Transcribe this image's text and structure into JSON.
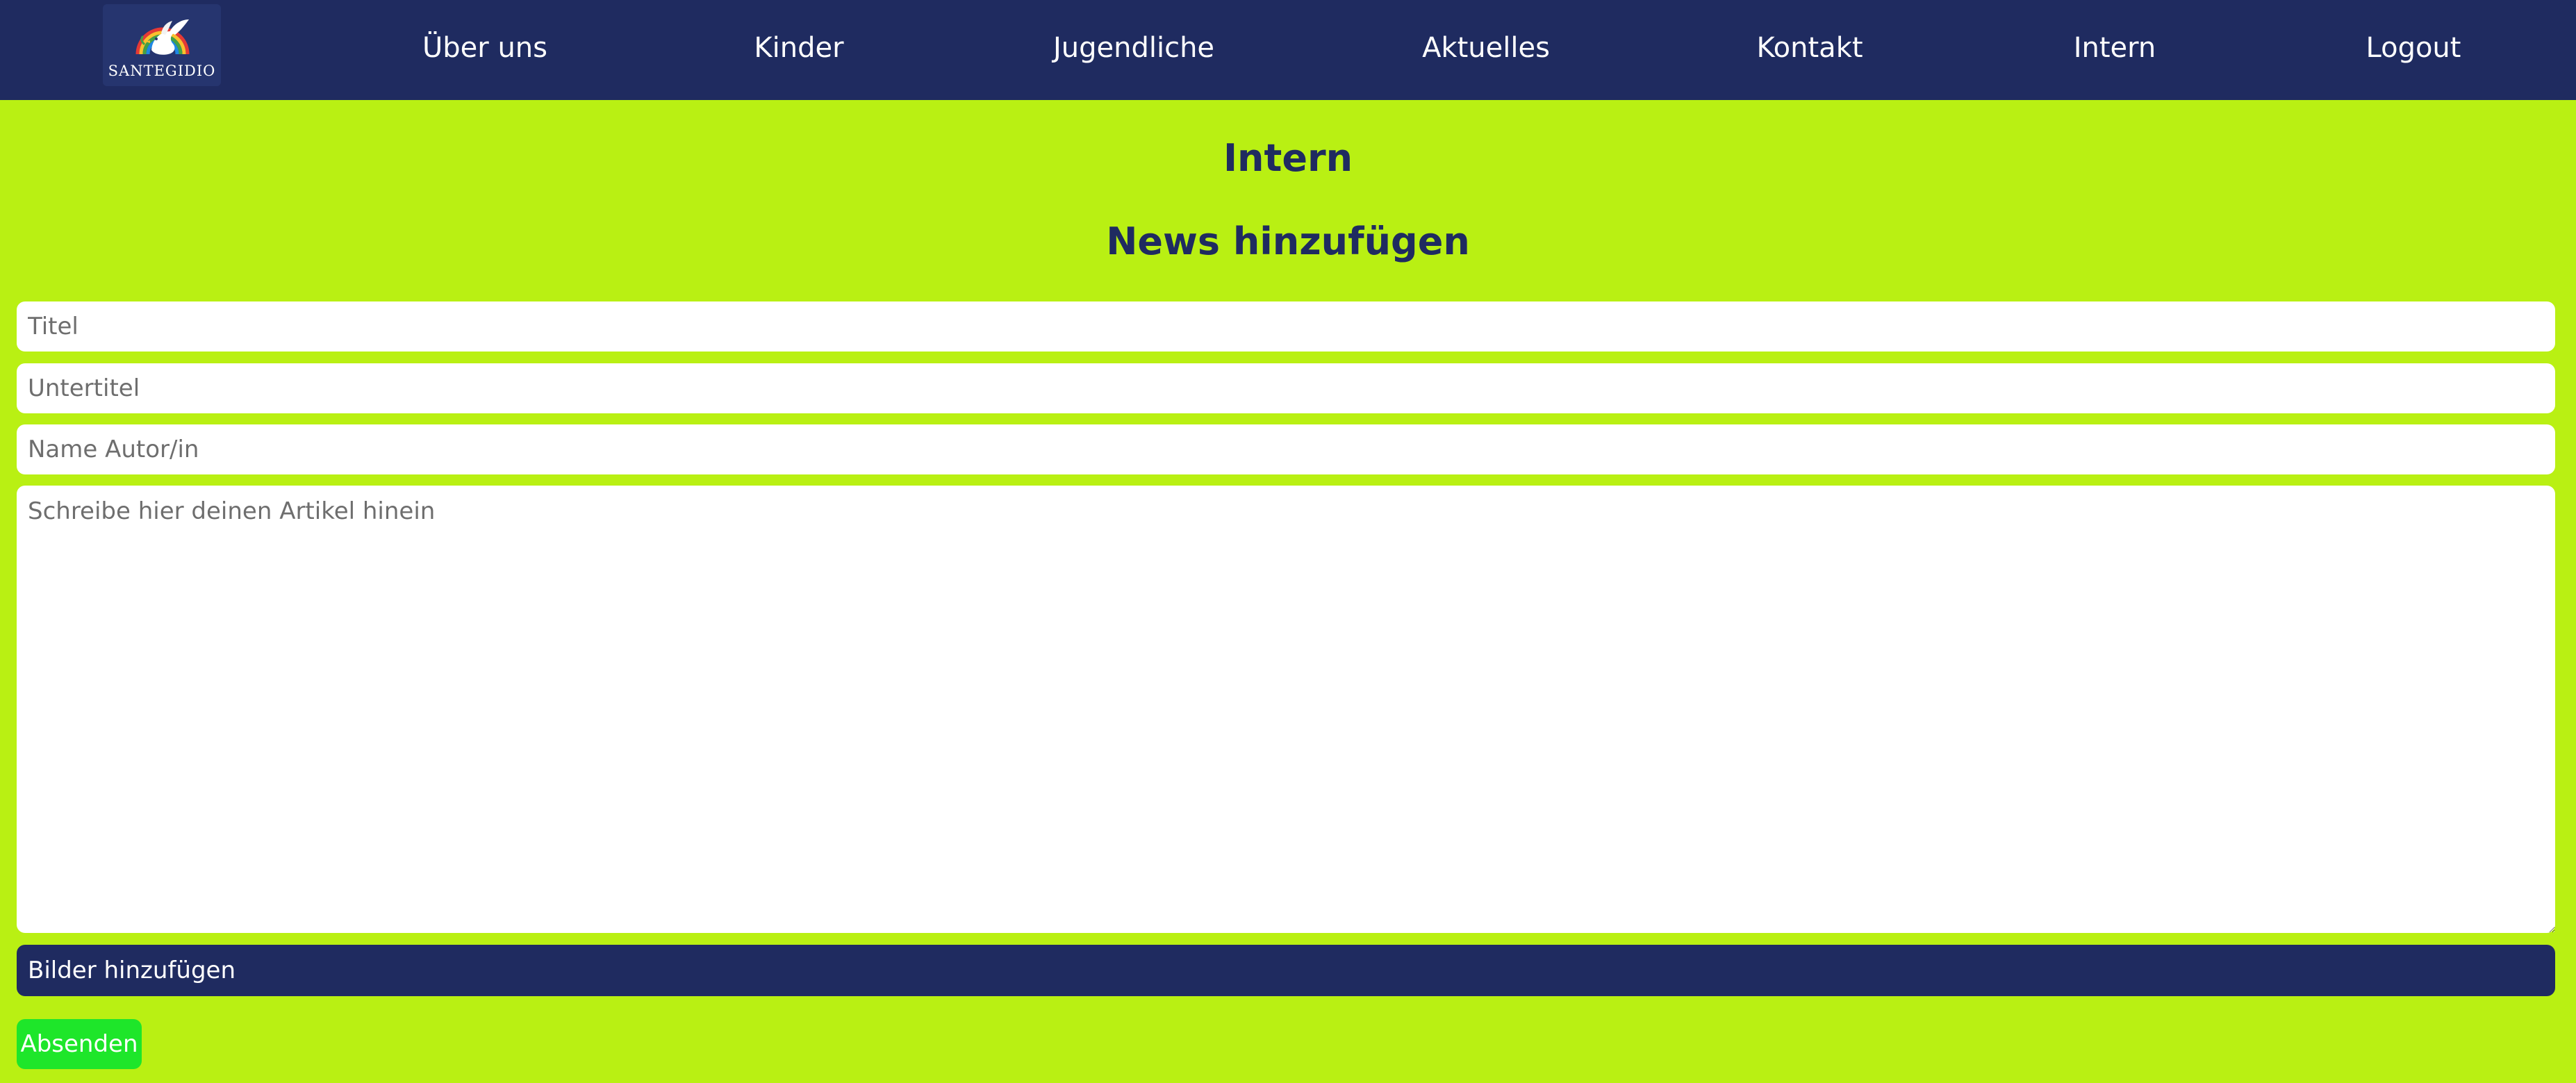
{
  "navbar": {
    "logo": {
      "icon": "dove-rainbow-icon",
      "text": "SANTEGIDIO"
    },
    "items": [
      {
        "label": "Über uns"
      },
      {
        "label": "Kinder"
      },
      {
        "label": "Jugendliche"
      },
      {
        "label": "Aktuelles"
      },
      {
        "label": "Kontakt"
      },
      {
        "label": "Intern"
      },
      {
        "label": "Logout"
      }
    ]
  },
  "page": {
    "title": "Intern",
    "subtitle": "News hinzufügen"
  },
  "form": {
    "title_placeholder": "Titel",
    "title_value": "",
    "subtitle_placeholder": "Untertitel",
    "subtitle_value": "",
    "author_placeholder": "Name Autor/in",
    "author_value": "",
    "article_placeholder": "Schreibe hier deinen Artikel hinein",
    "article_value": "",
    "add_images_label": "Bilder hinzufügen",
    "submit_label": "Absenden"
  },
  "colors": {
    "navbar": "#1f2b60",
    "page_background": "#b9f013",
    "heading": "#1f2b60",
    "add_images_button": "#1f2b60",
    "submit_button": "#1ee62a"
  }
}
